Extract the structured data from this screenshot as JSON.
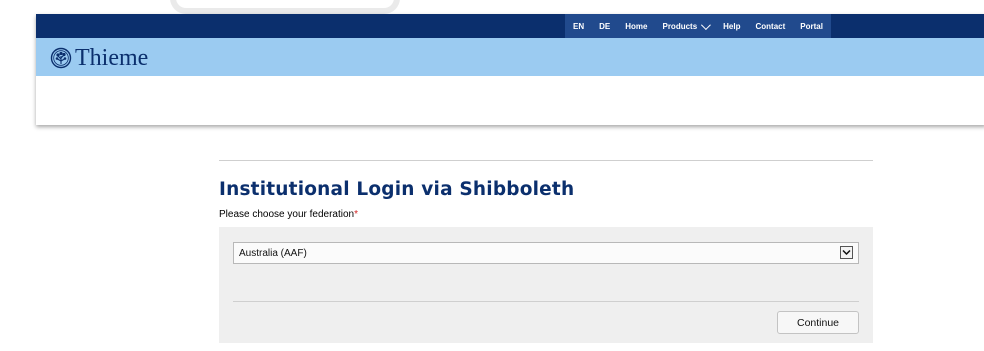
{
  "nav": {
    "items": [
      {
        "label": "EN"
      },
      {
        "label": "DE"
      },
      {
        "label": "Home"
      },
      {
        "label": "Products",
        "has_dropdown": true
      },
      {
        "label": "Help"
      },
      {
        "label": "Contact"
      },
      {
        "label": "Portal"
      }
    ]
  },
  "brand": {
    "name": "Thieme",
    "logo_icon": "tree-emblem-icon"
  },
  "main": {
    "title": "Institutional Login via Shibboleth",
    "federation_label": "Please choose your federation",
    "required_mark": "*",
    "federation_select": {
      "selected": "Australia (AAF)"
    },
    "continue_label": "Continue"
  },
  "colors": {
    "nav_bg": "#0b2f6d",
    "nav_menu_bg": "#214a8d",
    "brand_band": "#9bcbf1",
    "title": "#0b2f6d",
    "required": "#d22222",
    "panel_bg": "#efefef"
  }
}
